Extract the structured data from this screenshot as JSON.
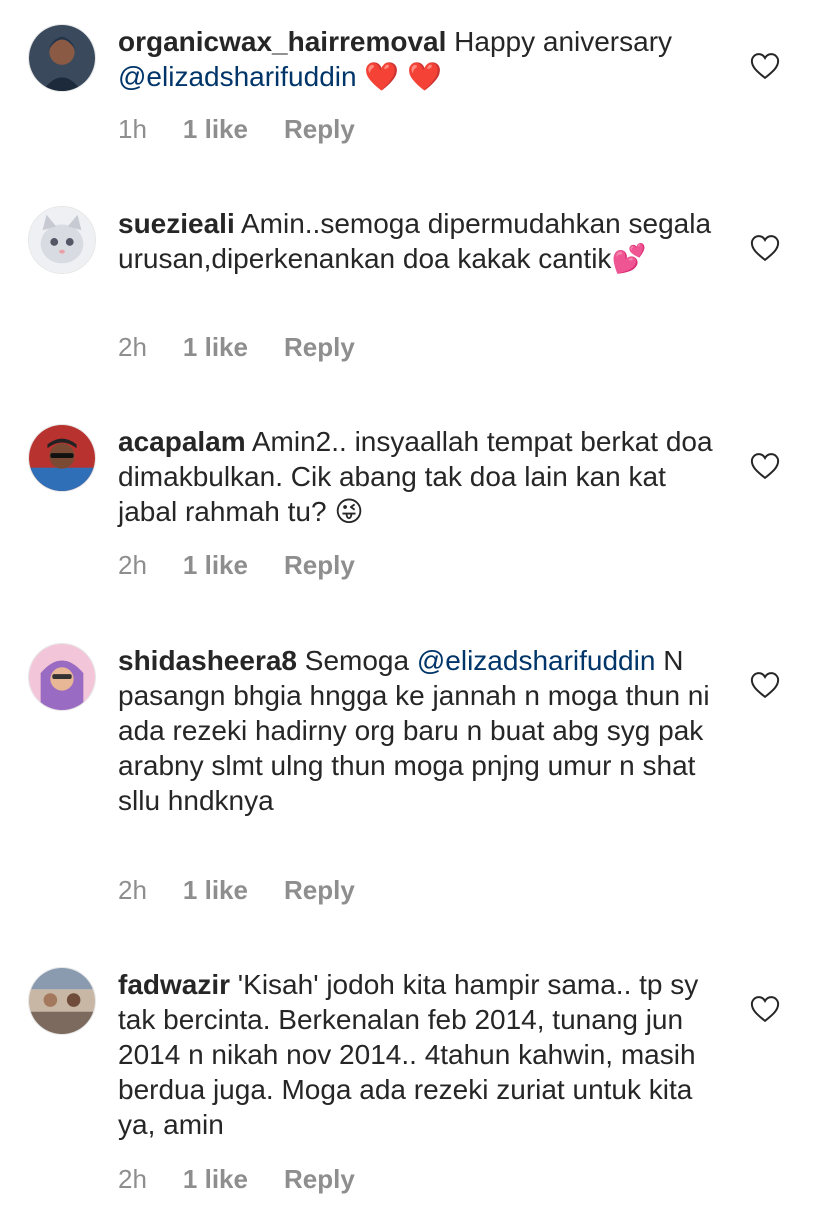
{
  "comments": [
    {
      "username": "organicwax_hairremoval",
      "pre": " Happy aniversary ",
      "mention": "@elizadsharifuddin",
      "post": "",
      "emoji": "❤️ ❤️",
      "time": "1h",
      "likes": "1 like",
      "reply": "Reply"
    },
    {
      "username": "suezieali",
      "pre": " Amin..semoga dipermudahkan segala urusan,diperkenankan doa kakak cantik",
      "mention": "",
      "post": "",
      "emoji": "💕",
      "time": "2h",
      "likes": "1 like",
      "reply": "Reply"
    },
    {
      "username": "acapalam",
      "pre": " Amin2.. insyaallah tempat berkat doa dimakbulkan. Cik abang tak doa lain kan kat jabal rahmah tu? ",
      "mention": "",
      "post": "",
      "emoji": "😜",
      "time": "2h",
      "likes": "1 like",
      "reply": "Reply"
    },
    {
      "username": "shidasheera8",
      "pre": " Semoga ",
      "mention": "@elizadsharifuddin",
      "post": "  N pasangn bhgia hngga ke jannah n moga thun ni ada rezeki hadirny org baru n buat abg syg pak arabny slmt ulng thun moga pnjng umur n shat sllu hndknya",
      "emoji": "",
      "time": "2h",
      "likes": "1 like",
      "reply": "Reply"
    },
    {
      "username": "fadwazir",
      "pre": " 'Kisah' jodoh kita hampir sama.. tp sy tak bercinta. Berkenalan feb 2014, tunang jun 2014 n nikah nov 2014.. 4tahun kahwin, masih berdua juga. Moga ada rezeki zuriat untuk kita ya, amin",
      "mention": "",
      "post": "",
      "emoji": "",
      "time": "2h",
      "likes": "1 like",
      "reply": "Reply"
    }
  ],
  "icons": {
    "like": "heart-outline-icon"
  },
  "colors": {
    "text": "#262626",
    "meta": "#8e8e8e",
    "mention": "#003569",
    "heart": "#e0245e"
  }
}
